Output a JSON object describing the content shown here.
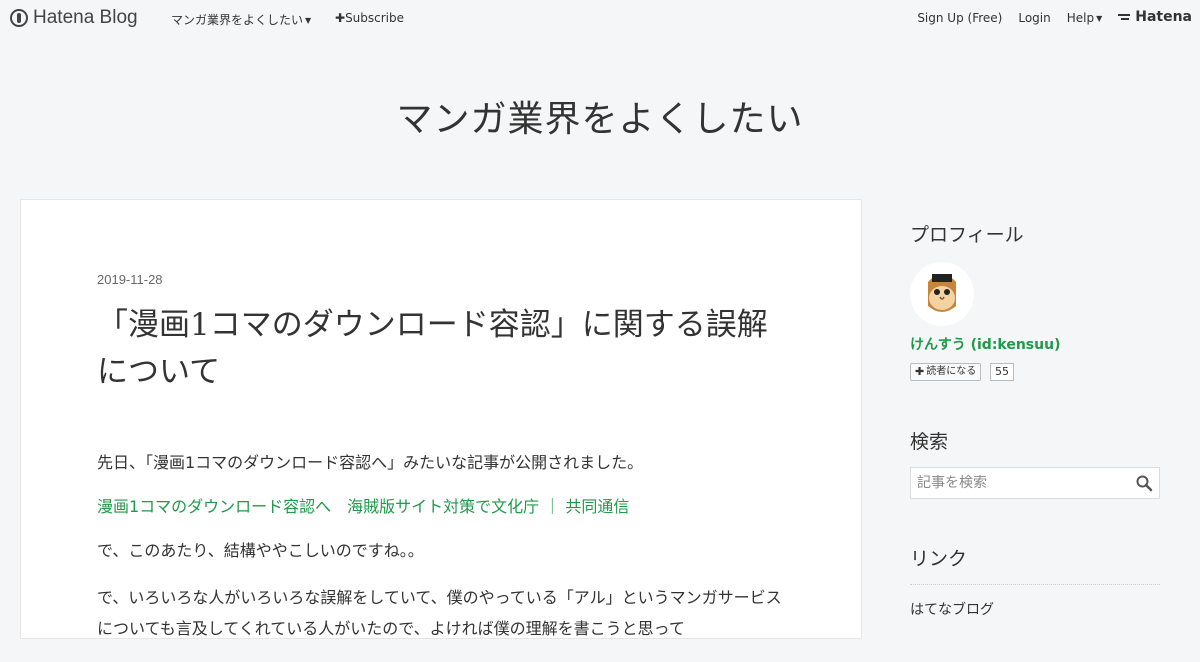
{
  "header": {
    "brand": "Hatena Blog",
    "blog_menu": "マンガ業界をよくしたい",
    "subscribe": "Subscribe",
    "signup": "Sign Up (Free)",
    "login": "Login",
    "help": "Help",
    "hatena": "Hatena",
    "icons": {
      "brand": "hatena-blog-logo-icon",
      "subscribe": "plus-icon",
      "dropdown": "caret-down-icon"
    }
  },
  "blog": {
    "title": "マンガ業界をよくしたい"
  },
  "entry": {
    "date": "2019-11-28",
    "title": "「漫画1コマのダウンロード容認」に関する誤解について",
    "paragraphs": [
      "先日、「漫画1コマのダウンロード容認へ」みたいな記事が公開されました。",
      "漫画1コマのダウンロード容認へ　海賊版サイト対策で文化庁 ｜ 共同通信",
      "で、このあたり、結構ややこしいのですね。。",
      "で、いろいろな人がいろいろな誤解をしていて、僕のやっている「アル」というマンガサービスについても言及してくれている人がいたので、よければ僕の理解を書こうと思って"
    ],
    "link_color": "#1f9a4a"
  },
  "sidebar": {
    "profile": {
      "heading": "プロフィール",
      "name": "けんすう (id:kensuu)",
      "reader_button": "読者になる",
      "reader_count": "55"
    },
    "search": {
      "heading": "検索",
      "placeholder": "記事を検索"
    },
    "links": {
      "heading": "リンク",
      "items": [
        "はてなブログ"
      ]
    }
  }
}
